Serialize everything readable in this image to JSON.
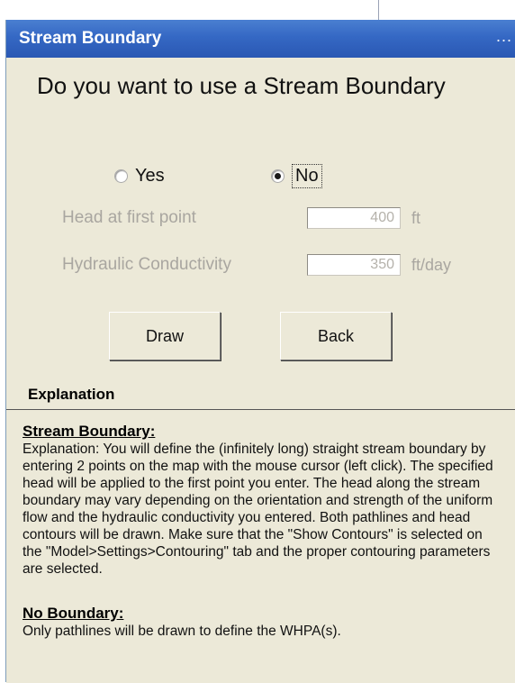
{
  "window": {
    "title": "Stream Boundary",
    "title_ellipsis": "..."
  },
  "question": "Do you want to use a Stream Boundary",
  "radio": {
    "yes_label": "Yes",
    "no_label": "No",
    "selected": "No"
  },
  "fields": {
    "head": {
      "label": "Head at first point",
      "value": "400",
      "unit": "ft",
      "enabled": false
    },
    "conductivity": {
      "label": "Hydraulic Conductivity",
      "value": "350",
      "unit": "ft/day",
      "enabled": false
    }
  },
  "buttons": {
    "draw_label": "Draw",
    "back_label": "Back"
  },
  "explanation": {
    "section_title": "Explanation",
    "stream_heading": "Stream Boundary:",
    "stream_text": "Explanation: You will define the (infinitely long) straight stream boundary by entering 2 points on the map with the mouse cursor (left click). The specified head will be applied to the first point you enter. The head along the stream boundary may vary depending on the orientation and strength of the uniform flow and the hydraulic conductivity you entered. Both pathlines and head contours will be drawn. Make sure that the \"Show Contours\" is selected on the \"Model>Settings>Contouring\" tab and the proper contouring parameters are selected.",
    "no_boundary_heading": "No Boundary:",
    "no_boundary_text": "Only pathlines will be drawn to define the WHPA(s)."
  },
  "colors": {
    "titlebar": "#2a58b3",
    "dialog_bg": "#ece9d8",
    "disabled_text": "#a9a6a0"
  }
}
